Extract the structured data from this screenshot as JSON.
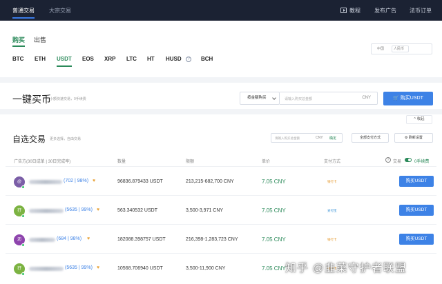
{
  "topnav": {
    "tabs": [
      "普通交易",
      "大宗交易"
    ],
    "right": [
      "教程",
      "发布广告",
      "法币订单"
    ]
  },
  "trade_tabs": [
    "购买",
    "出售"
  ],
  "coins": [
    "BTC",
    "ETH",
    "USDT",
    "EOS",
    "XRP",
    "LTC",
    "HT",
    "HUSD",
    "BCH"
  ],
  "selected_coin": "USDT",
  "fiat_selector": {
    "region": "中国",
    "currency": "人民币"
  },
  "quick_buy": {
    "title": "一键买币",
    "subtitle": "小额快速交易，0手续费",
    "mode": "按金额购买",
    "placeholder": "请输入购买总金额",
    "unit": "CNY",
    "button": "购买USDT"
  },
  "collapse_label": "收起",
  "optional": {
    "title": "自选交易",
    "subtitle": "更多选择，自由交易",
    "amount_placeholder": "请输入购买总金额",
    "amount_unit": "CNY",
    "confirm": "确定",
    "pay_filter": "全部支付方式",
    "refresh": "刷新设置"
  },
  "table_headers": {
    "merchant": "广告方(30日成单 | 30日完成率)",
    "quantity": "数量",
    "limit": "限额",
    "price": "单价",
    "payment": "支付方式",
    "action": "交易",
    "zero_fee": "0手续费"
  },
  "listings": [
    {
      "stats": "(702 | 98%)",
      "avatar": "@",
      "avatar_color": "#7b5ea7",
      "quantity": "96836.879433 USDT",
      "limit": "213,215-682,700 CNY",
      "price": "7.05 CNY",
      "payment": "银行卡",
      "button": "购买USDT"
    },
    {
      "stats": "(5635 | 99%)",
      "avatar": "孖",
      "avatar_color": "#7cb342",
      "quantity": "563.340532 USDT",
      "limit": "3,500-3,971 CNY",
      "price": "7.05 CNY",
      "payment": "支付宝",
      "button": "购买USDT"
    },
    {
      "stats": "(684 | 98%)",
      "avatar": "沥",
      "avatar_color": "#8e44ad",
      "quantity": "182088.398757 USDT",
      "limit": "216,398-1,283,723 CNY",
      "price": "7.05 CNY",
      "payment": "银行卡",
      "button": "购买USDT"
    },
    {
      "stats": "(5635 | 99%)",
      "avatar": "孖",
      "avatar_color": "#7cb342",
      "quantity": "10568.706940 USDT",
      "limit": "3,500-11,900 CNY",
      "price": "7.05 CNY",
      "payment": "银行卡",
      "button": "购买USDT"
    }
  ],
  "watermark": "知乎 @韭菜守护者联盟",
  "colors": {
    "nav_bg": "#1b2233",
    "accent_green": "#2b8a5a",
    "button_blue": "#3d82e6"
  }
}
